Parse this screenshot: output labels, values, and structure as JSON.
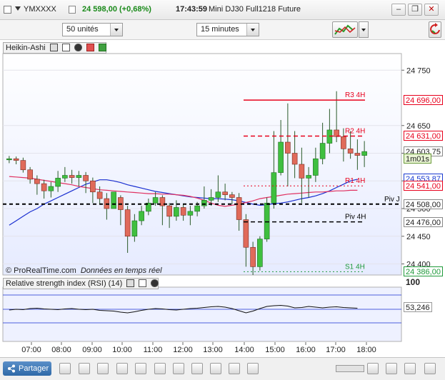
{
  "header": {
    "symbol": "YMXXXX",
    "price_change": "24 598,00 (+0,68%)",
    "time": "17:43:59",
    "instrument": "Mini DJ30 Full1218 Future",
    "buttons": [
      "minimize-icon",
      "restore-icon",
      "close-icon"
    ]
  },
  "toolbar": {
    "units_value": "50 unités",
    "interval_value": "15 minutes"
  },
  "main_panel": {
    "title": "Heikin-Ashi",
    "watermark": "© ProRealTime.com",
    "watermark_note": "Données en temps réel"
  },
  "rsi_panel": {
    "title": "Relative strength index (RSI) (14)",
    "scale_top": "100",
    "value": "53,246"
  },
  "bottom": {
    "share_label": "Partager"
  },
  "chart_data": {
    "type": "candlestick",
    "y_axis_ticks": [
      "24 750",
      "24 650",
      "24 600",
      "24 550",
      "24 500",
      "24 450",
      "24 400"
    ],
    "x_axis_ticks": [
      "07:00",
      "08:00",
      "09:00",
      "10:00",
      "11:00",
      "12:00",
      "13:00",
      "14:00",
      "15:00",
      "16:00",
      "17:00",
      "18:00"
    ],
    "ylim": [
      24380,
      24780
    ],
    "price_tags": [
      {
        "text": "24 696,00",
        "value": 24696,
        "color": "#e8001c"
      },
      {
        "text": "24 631,00",
        "value": 24631,
        "color": "#e8001c"
      },
      {
        "text": "24 603,75",
        "value": 24603.75,
        "color": "#222222"
      },
      {
        "text": "1m01s",
        "value": 24590,
        "color": "#222222"
      },
      {
        "text": "24 553,87",
        "value": 24553.87,
        "color": "#1a3ad0"
      },
      {
        "text": "24 541,00",
        "value": 24541,
        "color": "#e8001c"
      },
      {
        "text": "24 508,00",
        "value": 24508,
        "color": "#222222"
      },
      {
        "text": "24 476,00",
        "value": 24476,
        "color": "#222222"
      },
      {
        "text": "24 386,00",
        "value": 24386,
        "color": "#1f9a3a"
      }
    ],
    "pivot_levels": [
      {
        "label": "R3 4H",
        "value": 24696,
        "color": "#e8001c",
        "style": "solid"
      },
      {
        "label": "R2 4H",
        "value": 24631,
        "color": "#e8001c",
        "style": "dashed"
      },
      {
        "label": "R1 4H",
        "value": 24541,
        "color": "#e8001c",
        "style": "dotted"
      },
      {
        "label": "Piv J",
        "value": 24508,
        "color": "#000000",
        "style": "dashed"
      },
      {
        "label": "Piv 4H",
        "value": 24476,
        "color": "#000000",
        "style": "dashed"
      },
      {
        "label": "S1 4H",
        "value": 24386,
        "color": "#1f9a3a",
        "style": "dotted"
      }
    ],
    "candles": [
      {
        "o": 24588,
        "c": 24590,
        "h": 24595,
        "l": 24582
      },
      {
        "o": 24590,
        "c": 24587,
        "h": 24594,
        "l": 24580
      },
      {
        "o": 24587,
        "c": 24570,
        "h": 24592,
        "l": 24565
      },
      {
        "o": 24570,
        "c": 24553,
        "h": 24575,
        "l": 24545
      },
      {
        "o": 24553,
        "c": 24545,
        "h": 24560,
        "l": 24525
      },
      {
        "o": 24545,
        "c": 24532,
        "h": 24552,
        "l": 24518
      },
      {
        "o": 24532,
        "c": 24540,
        "h": 24548,
        "l": 24520
      },
      {
        "o": 24540,
        "c": 24555,
        "h": 24568,
        "l": 24530
      },
      {
        "o": 24555,
        "c": 24560,
        "h": 24575,
        "l": 24548
      },
      {
        "o": 24560,
        "c": 24556,
        "h": 24570,
        "l": 24545
      },
      {
        "o": 24556,
        "c": 24560,
        "h": 24568,
        "l": 24540
      },
      {
        "o": 24560,
        "c": 24550,
        "h": 24566,
        "l": 24528
      },
      {
        "o": 24550,
        "c": 24530,
        "h": 24556,
        "l": 24510
      },
      {
        "o": 24530,
        "c": 24518,
        "h": 24540,
        "l": 24508
      },
      {
        "o": 24518,
        "c": 24500,
        "h": 24528,
        "l": 24480
      },
      {
        "o": 24500,
        "c": 24530,
        "h": 24520,
        "l": 24500
      },
      {
        "o": 24520,
        "c": 24498,
        "h": 24524,
        "l": 24470
      },
      {
        "o": 24498,
        "c": 24450,
        "h": 24505,
        "l": 24420
      },
      {
        "o": 24450,
        "c": 24478,
        "h": 24490,
        "l": 24440
      },
      {
        "o": 24478,
        "c": 24495,
        "h": 24505,
        "l": 24470
      },
      {
        "o": 24495,
        "c": 24510,
        "h": 24518,
        "l": 24488
      },
      {
        "o": 24510,
        "c": 24520,
        "h": 24530,
        "l": 24505
      },
      {
        "o": 24520,
        "c": 24505,
        "h": 24524,
        "l": 24470
      },
      {
        "o": 24505,
        "c": 24486,
        "h": 24510,
        "l": 24465
      },
      {
        "o": 24486,
        "c": 24502,
        "h": 24515,
        "l": 24478
      },
      {
        "o": 24502,
        "c": 24488,
        "h": 24508,
        "l": 24478
      },
      {
        "o": 24488,
        "c": 24495,
        "h": 24505,
        "l": 24470
      },
      {
        "o": 24495,
        "c": 24505,
        "h": 24512,
        "l": 24486
      },
      {
        "o": 24505,
        "c": 24515,
        "h": 24540,
        "l": 24500
      },
      {
        "o": 24515,
        "c": 24520,
        "h": 24535,
        "l": 24505
      },
      {
        "o": 24520,
        "c": 24530,
        "h": 24560,
        "l": 24512
      },
      {
        "o": 24530,
        "c": 24525,
        "h": 24545,
        "l": 24515
      },
      {
        "o": 24525,
        "c": 24520,
        "h": 24530,
        "l": 24508
      },
      {
        "o": 24520,
        "c": 24480,
        "h": 24528,
        "l": 24460
      },
      {
        "o": 24480,
        "c": 24430,
        "h": 24490,
        "l": 24395
      },
      {
        "o": 24430,
        "c": 24395,
        "h": 24440,
        "l": 24380
      },
      {
        "o": 24395,
        "c": 24445,
        "h": 24450,
        "l": 24388
      },
      {
        "o": 24445,
        "c": 24510,
        "h": 24520,
        "l": 24440
      },
      {
        "o": 24510,
        "c": 24565,
        "h": 24640,
        "l": 24500
      },
      {
        "o": 24565,
        "c": 24620,
        "h": 24660,
        "l": 24560
      },
      {
        "o": 24620,
        "c": 24600,
        "h": 24690,
        "l": 24540
      },
      {
        "o": 24600,
        "c": 24580,
        "h": 24640,
        "l": 24555
      },
      {
        "o": 24580,
        "c": 24555,
        "h": 24610,
        "l": 24510
      },
      {
        "o": 24555,
        "c": 24560,
        "h": 24575,
        "l": 24520
      },
      {
        "o": 24560,
        "c": 24590,
        "h": 24610,
        "l": 24548
      },
      {
        "o": 24590,
        "c": 24618,
        "h": 24655,
        "l": 24580
      },
      {
        "o": 24618,
        "c": 24642,
        "h": 24680,
        "l": 24600
      },
      {
        "o": 24642,
        "c": 24630,
        "h": 24712,
        "l": 24620
      },
      {
        "o": 24630,
        "c": 24608,
        "h": 24645,
        "l": 24585
      },
      {
        "o": 24608,
        "c": 24600,
        "h": 24640,
        "l": 24590
      },
      {
        "o": 24600,
        "c": 24596,
        "h": 24625,
        "l": 24570
      },
      {
        "o": 24596,
        "c": 24603,
        "h": 24622,
        "l": 24575
      }
    ],
    "ma_blue": [
      24470,
      24478,
      24486,
      24494,
      24500,
      24508,
      24514,
      24520,
      24526,
      24532,
      24538,
      24544,
      24548,
      24552,
      24552,
      24550,
      24547,
      24543,
      24540,
      24537,
      24534,
      24531,
      24529,
      24527,
      24525,
      24523,
      24521,
      24520,
      24519,
      24518,
      24518,
      24517,
      24516,
      24514,
      24511,
      24508,
      24506,
      24507,
      24509,
      24510,
      24512,
      24515,
      24518,
      24520,
      24523,
      24527,
      24532,
      24538,
      24544,
      24550,
      24553
    ],
    "ma_red": [
      24558,
      24557,
      24556,
      24555,
      24553,
      24551,
      24549,
      24547,
      24545,
      24543,
      24540,
      24538,
      24536,
      24534,
      24533,
      24532,
      24531,
      24530,
      24529,
      24528,
      24527,
      24527,
      24526,
      24526,
      24525,
      24524,
      24522,
      24519,
      24515,
      24510,
      24506,
      24504,
      24506,
      24508,
      24511,
      24514,
      24518,
      24520,
      24522,
      24524,
      24526,
      24527,
      24528,
      24529,
      24530,
      24530,
      24531,
      24532,
      24532,
      24533,
      24533
    ],
    "rsi": [
      48,
      50,
      49,
      52,
      53,
      51,
      50,
      49,
      51,
      52,
      50,
      49,
      50,
      47,
      46,
      45,
      42,
      40,
      43,
      47,
      50,
      52,
      51,
      49,
      48,
      50,
      52,
      53,
      55,
      57,
      58,
      56,
      52,
      46,
      40,
      45,
      52,
      58,
      60,
      61,
      59,
      54,
      55,
      58,
      56,
      54,
      56,
      57,
      55,
      54,
      53
    ]
  }
}
